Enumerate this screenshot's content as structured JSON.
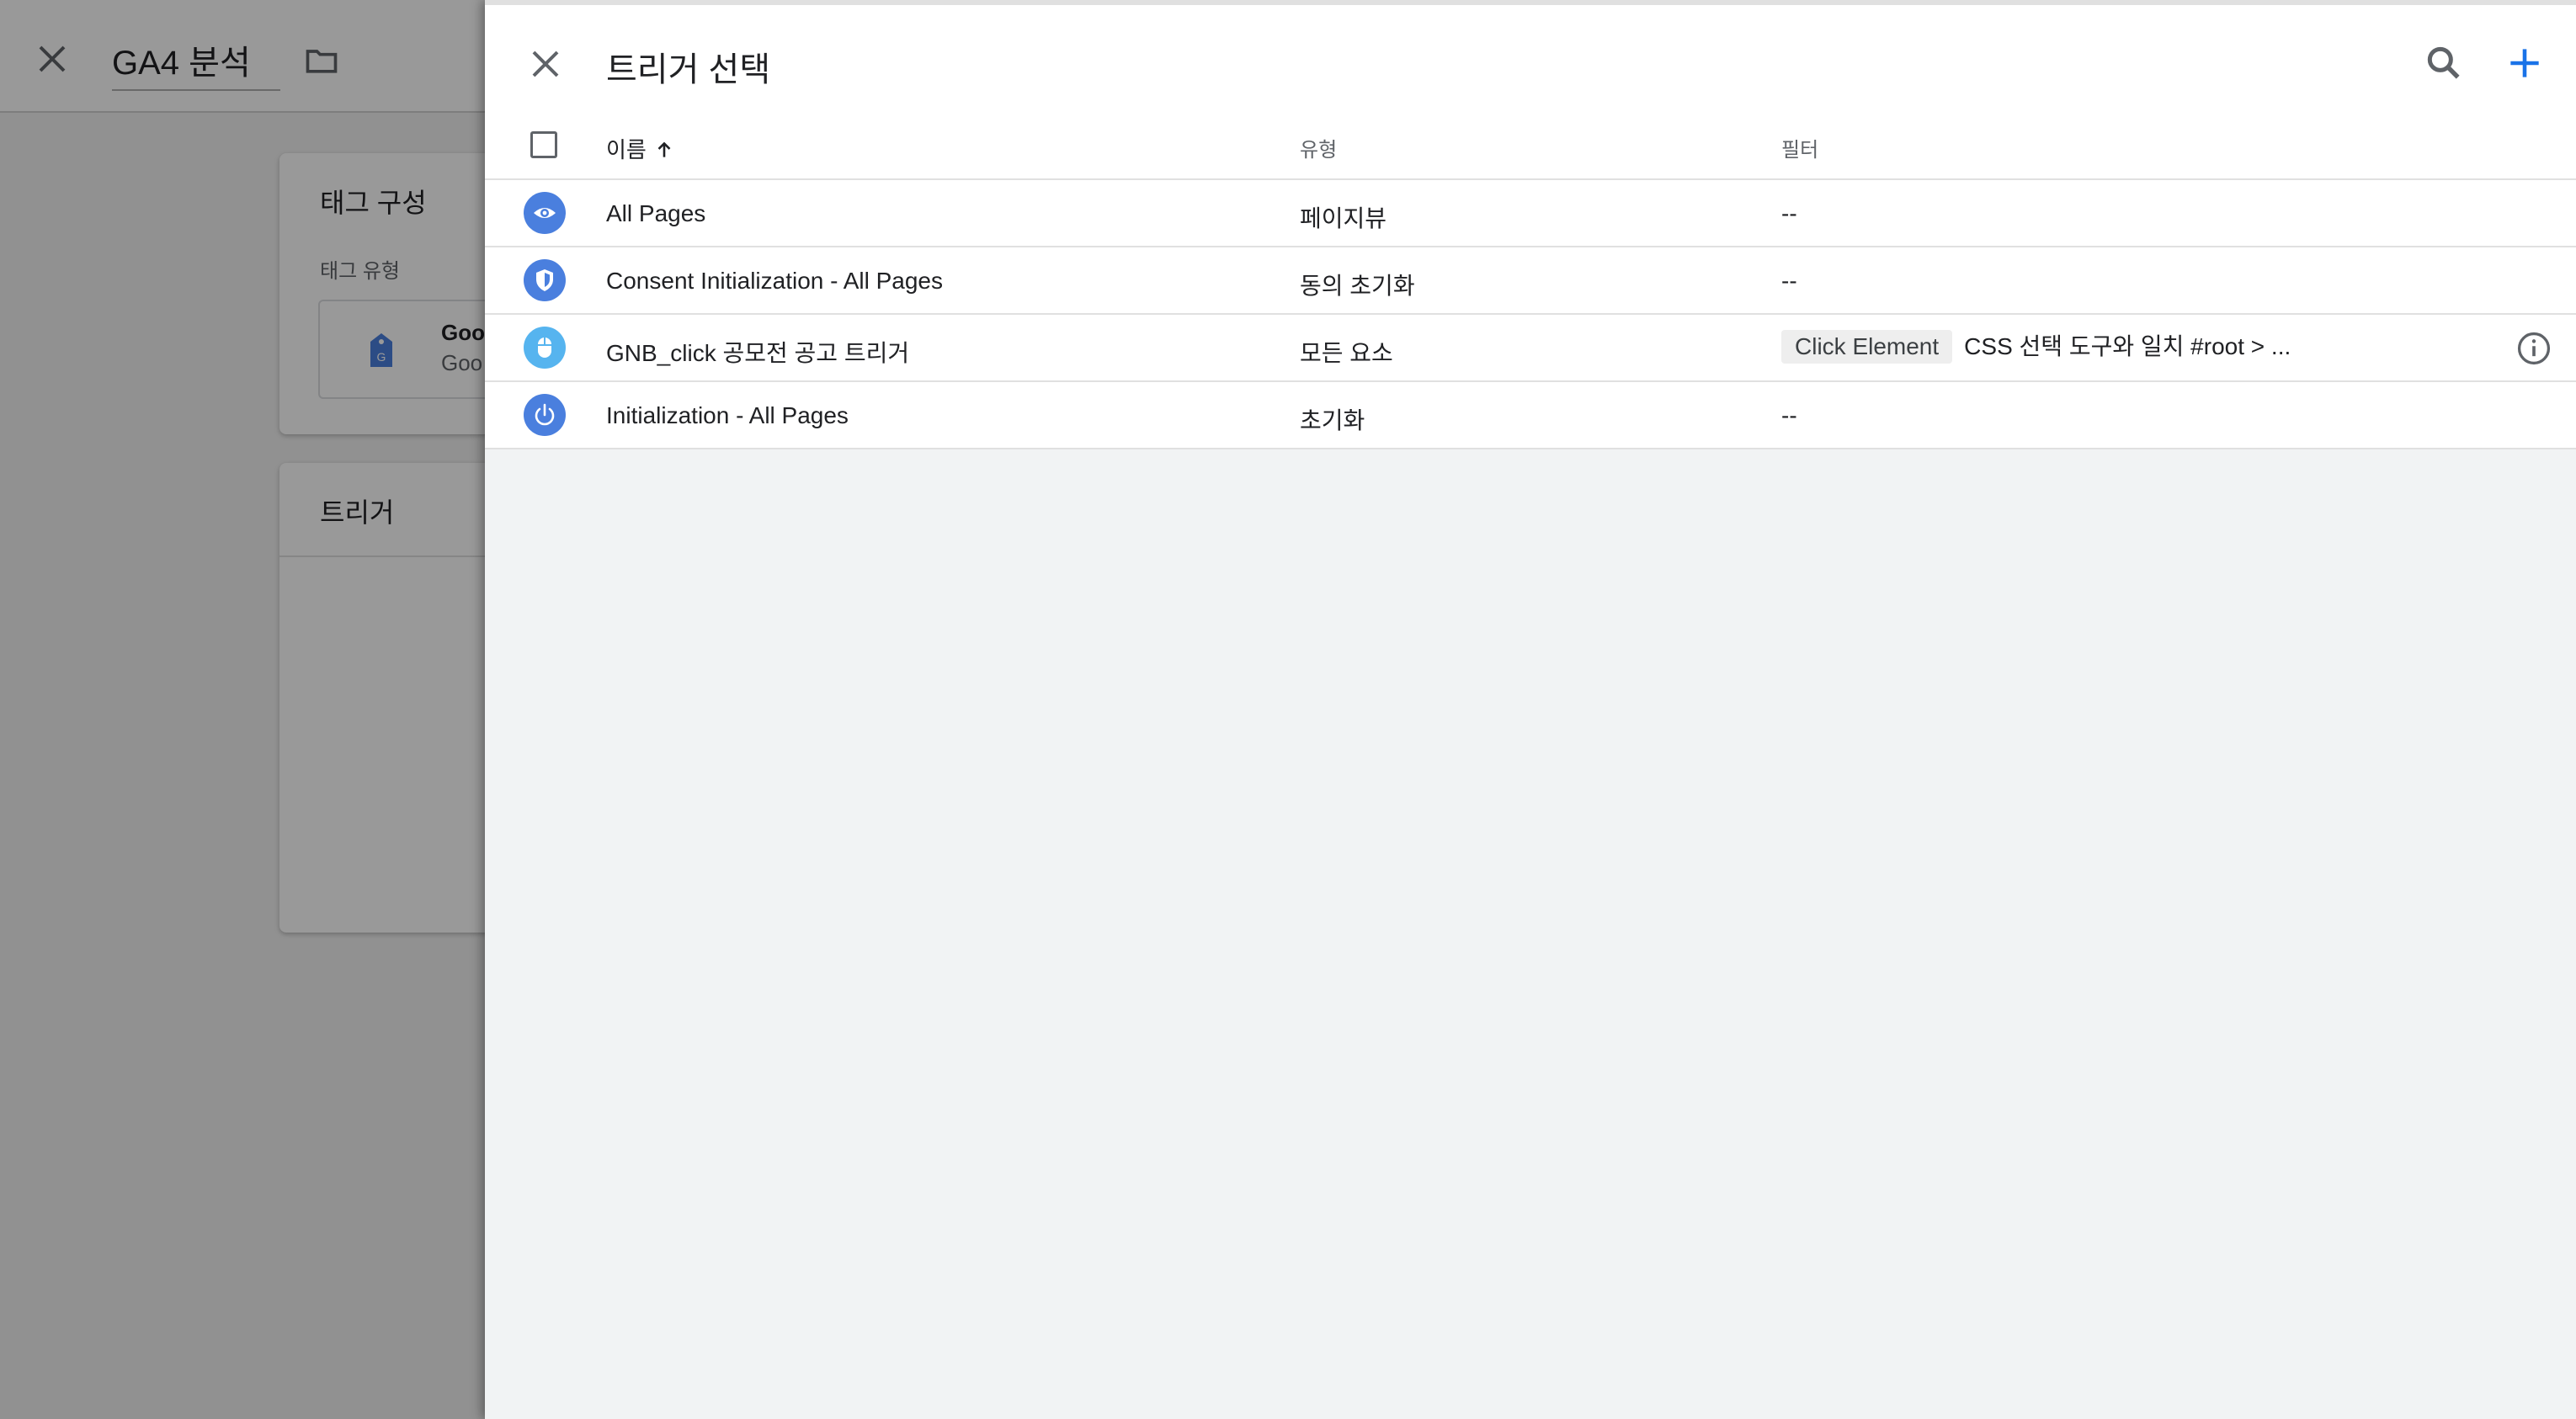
{
  "background_editor": {
    "title": "GA4 분석",
    "tag_config_title": "태그 구성",
    "tag_type_label": "태그 유형",
    "tag_name_partial": "Goo",
    "tag_sub_partial": "Goo",
    "triggers_title": "트리거"
  },
  "panel": {
    "title": "트리거 선택",
    "columns": {
      "name": "이름",
      "type": "유형",
      "filter": "필터"
    },
    "rows": [
      {
        "name": "All Pages",
        "type": "페이지뷰",
        "filter": "--",
        "icon": "eye-icon",
        "icon_color": "#4a7fde"
      },
      {
        "name": "Consent Initialization - All Pages",
        "type": "동의 초기화",
        "filter": "--",
        "icon": "shield-icon",
        "icon_color": "#4a7fde"
      },
      {
        "name": "GNB_click 공모전 공고 트리거",
        "type": "모든 요소",
        "filter_chip": "Click Element",
        "filter": "CSS 선택 도구와 일치 #root > ...",
        "icon": "mouse-icon",
        "icon_color": "#56b4ef"
      },
      {
        "name": "Initialization - All Pages",
        "type": "초기화",
        "filter": "--",
        "icon": "power-icon",
        "icon_color": "#4a7fde"
      }
    ]
  },
  "colors": {
    "accent_blue": "#1a73e8",
    "icon_blue": "#4a7fde",
    "icon_light_blue": "#56b4ef"
  }
}
